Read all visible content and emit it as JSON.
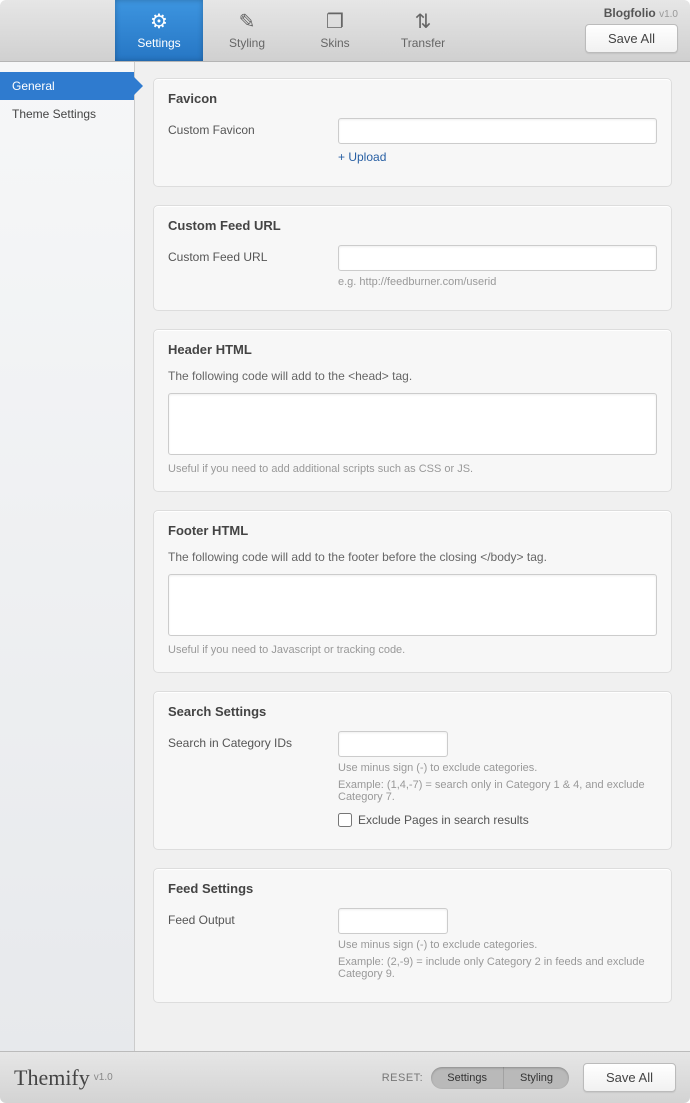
{
  "header": {
    "app_name": "Blogfolio",
    "app_version": "v1.0",
    "save_label": "Save All",
    "tabs": [
      {
        "icon": "⚙",
        "label": "Settings"
      },
      {
        "icon": "✎",
        "label": "Styling"
      },
      {
        "icon": "❐",
        "label": "Skins"
      },
      {
        "icon": "⇅",
        "label": "Transfer"
      }
    ]
  },
  "sidebar": {
    "items": [
      {
        "label": "General",
        "active": true
      },
      {
        "label": "Theme Settings",
        "active": false
      }
    ]
  },
  "sections": {
    "favicon": {
      "title": "Favicon",
      "label": "Custom Favicon",
      "value": "",
      "upload": "+ Upload"
    },
    "feed_url": {
      "title": "Custom Feed URL",
      "label": "Custom Feed URL",
      "value": "",
      "hint": "e.g. http://feedburner.com/userid"
    },
    "header_html": {
      "title": "Header HTML",
      "desc": "The following code will add to the <head> tag.",
      "value": "",
      "hint": "Useful if you need to add additional scripts such as CSS or JS."
    },
    "footer_html": {
      "title": "Footer HTML",
      "desc": "The following code will add to the footer before the closing </body> tag.",
      "value": "",
      "hint": "Useful if you need to Javascript or tracking code."
    },
    "search": {
      "title": "Search Settings",
      "label": "Search in Category IDs",
      "value": "",
      "hint1": "Use minus sign (-) to exclude categories.",
      "hint2": "Example: (1,4,-7) = search only in Category 1 & 4, and exclude Category 7.",
      "checkbox_label": "Exclude Pages in search results",
      "checkbox_value": false
    },
    "feed": {
      "title": "Feed Settings",
      "label": "Feed Output",
      "value": "",
      "hint1": "Use minus sign (-) to exclude categories.",
      "hint2": "Example: (2,-9) = include only Category 2 in feeds and exclude Category 9."
    }
  },
  "footer": {
    "brand": "Themify",
    "brand_version": "v1.0",
    "reset_label": "RESET:",
    "reset_settings": "Settings",
    "reset_styling": "Styling",
    "save_label": "Save All"
  }
}
